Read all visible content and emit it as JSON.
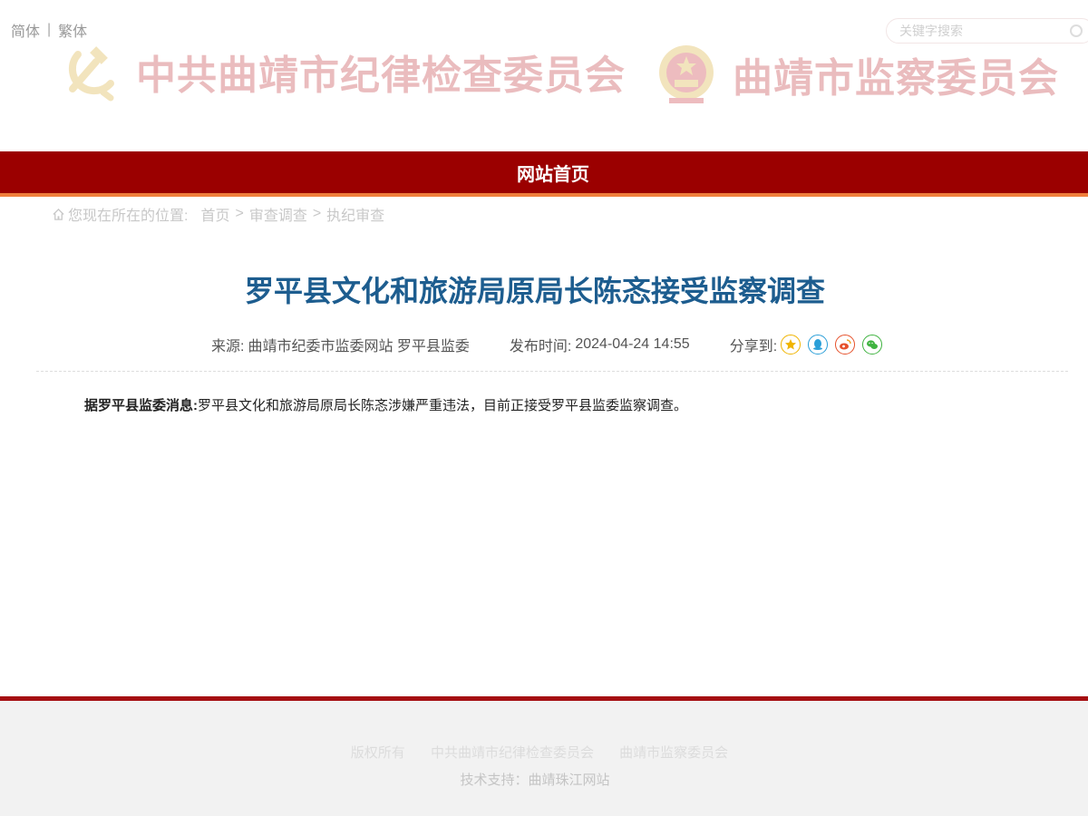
{
  "header": {
    "lang_simplified": "简体",
    "lang_separator": "|",
    "lang_traditional": "繁体",
    "search_placeholder": "关键字搜索",
    "banner_left_title": "中共曲靖市纪律检查委员会",
    "banner_right_title": "曲靖市监察委员会"
  },
  "nav": {
    "home_label": "网站首页"
  },
  "breadcrumb": {
    "prefix": "您现在所在的位置:",
    "items": [
      "首页",
      "审查调查",
      "执纪审查"
    ],
    "separator": ">"
  },
  "article": {
    "title": "罗平县文化和旅游局原局长陈忞接受监察调查",
    "source_label": "来源:",
    "source_value": "曲靖市纪委市监委网站 罗平县监委",
    "time_label": "发布时间:",
    "time_value": "2024-04-24 14:55",
    "share_label": "分享到:",
    "share_icons": [
      "star-icon",
      "qq-icon",
      "weibo-icon",
      "wechat-icon"
    ],
    "lead": "据罗平县监委消息:",
    "body": "罗平县文化和旅游局原局长陈忞涉嫌严重违法，目前正接受罗平县监委监察调查。"
  },
  "footer": {
    "links": [
      "版权所有",
      "中共曲靖市纪律检查委员会",
      "曲靖市监察委员会"
    ],
    "support": "技术支持：曲靖珠江网站"
  },
  "colors": {
    "nav_red": "#9b0000",
    "nav_underline_orange": "#f07f3c",
    "title_blue": "#1d5d8f",
    "footer_red": "#a50f12"
  }
}
